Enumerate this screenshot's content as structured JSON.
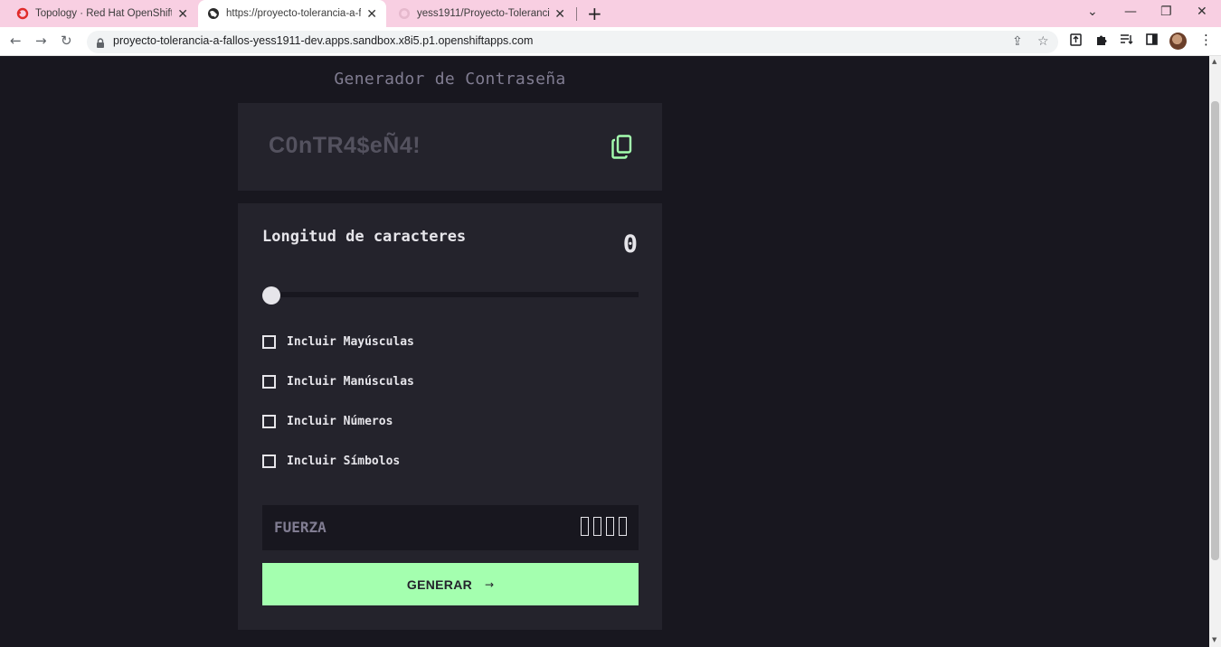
{
  "browser": {
    "tabs": [
      {
        "title": "Topology · Red Hat OpenShift De",
        "icon": "openshift-icon",
        "active": false
      },
      {
        "title": "https://proyecto-tolerancia-a-fall",
        "icon": "globe-icon",
        "active": true
      },
      {
        "title": "yess1911/Proyecto-Tolerancia-a-",
        "icon": "github-icon",
        "active": false
      }
    ],
    "new_tab_symbol": "+",
    "url": "proyecto-tolerancia-a-fallos-yess1911-dev.apps.sandbox.x8i5.p1.openshiftapps.com"
  },
  "app": {
    "title": "Generador de Contraseña",
    "password_placeholder": "C0nTR4$eÑ4!",
    "length_label": "Longitud de caracteres",
    "length_value": "0",
    "slider_fraction": 0,
    "options": [
      {
        "label": "Incluir Mayúsculas",
        "checked": false
      },
      {
        "label": "Incluir Manúsculas",
        "checked": false
      },
      {
        "label": "Incluir Números",
        "checked": false
      },
      {
        "label": "Incluir Símbolos",
        "checked": false
      }
    ],
    "strength_label": "FUERZA",
    "strength_level": 0,
    "generate_label": "GENERAR",
    "generate_arrow": "→"
  },
  "colors": {
    "background": "#18171f",
    "panel": "#24232c",
    "accent_green": "#a4ffaf",
    "text_light": "#e6e5ea",
    "text_muted": "#817d92",
    "tabbar": "#f8cfe2"
  }
}
